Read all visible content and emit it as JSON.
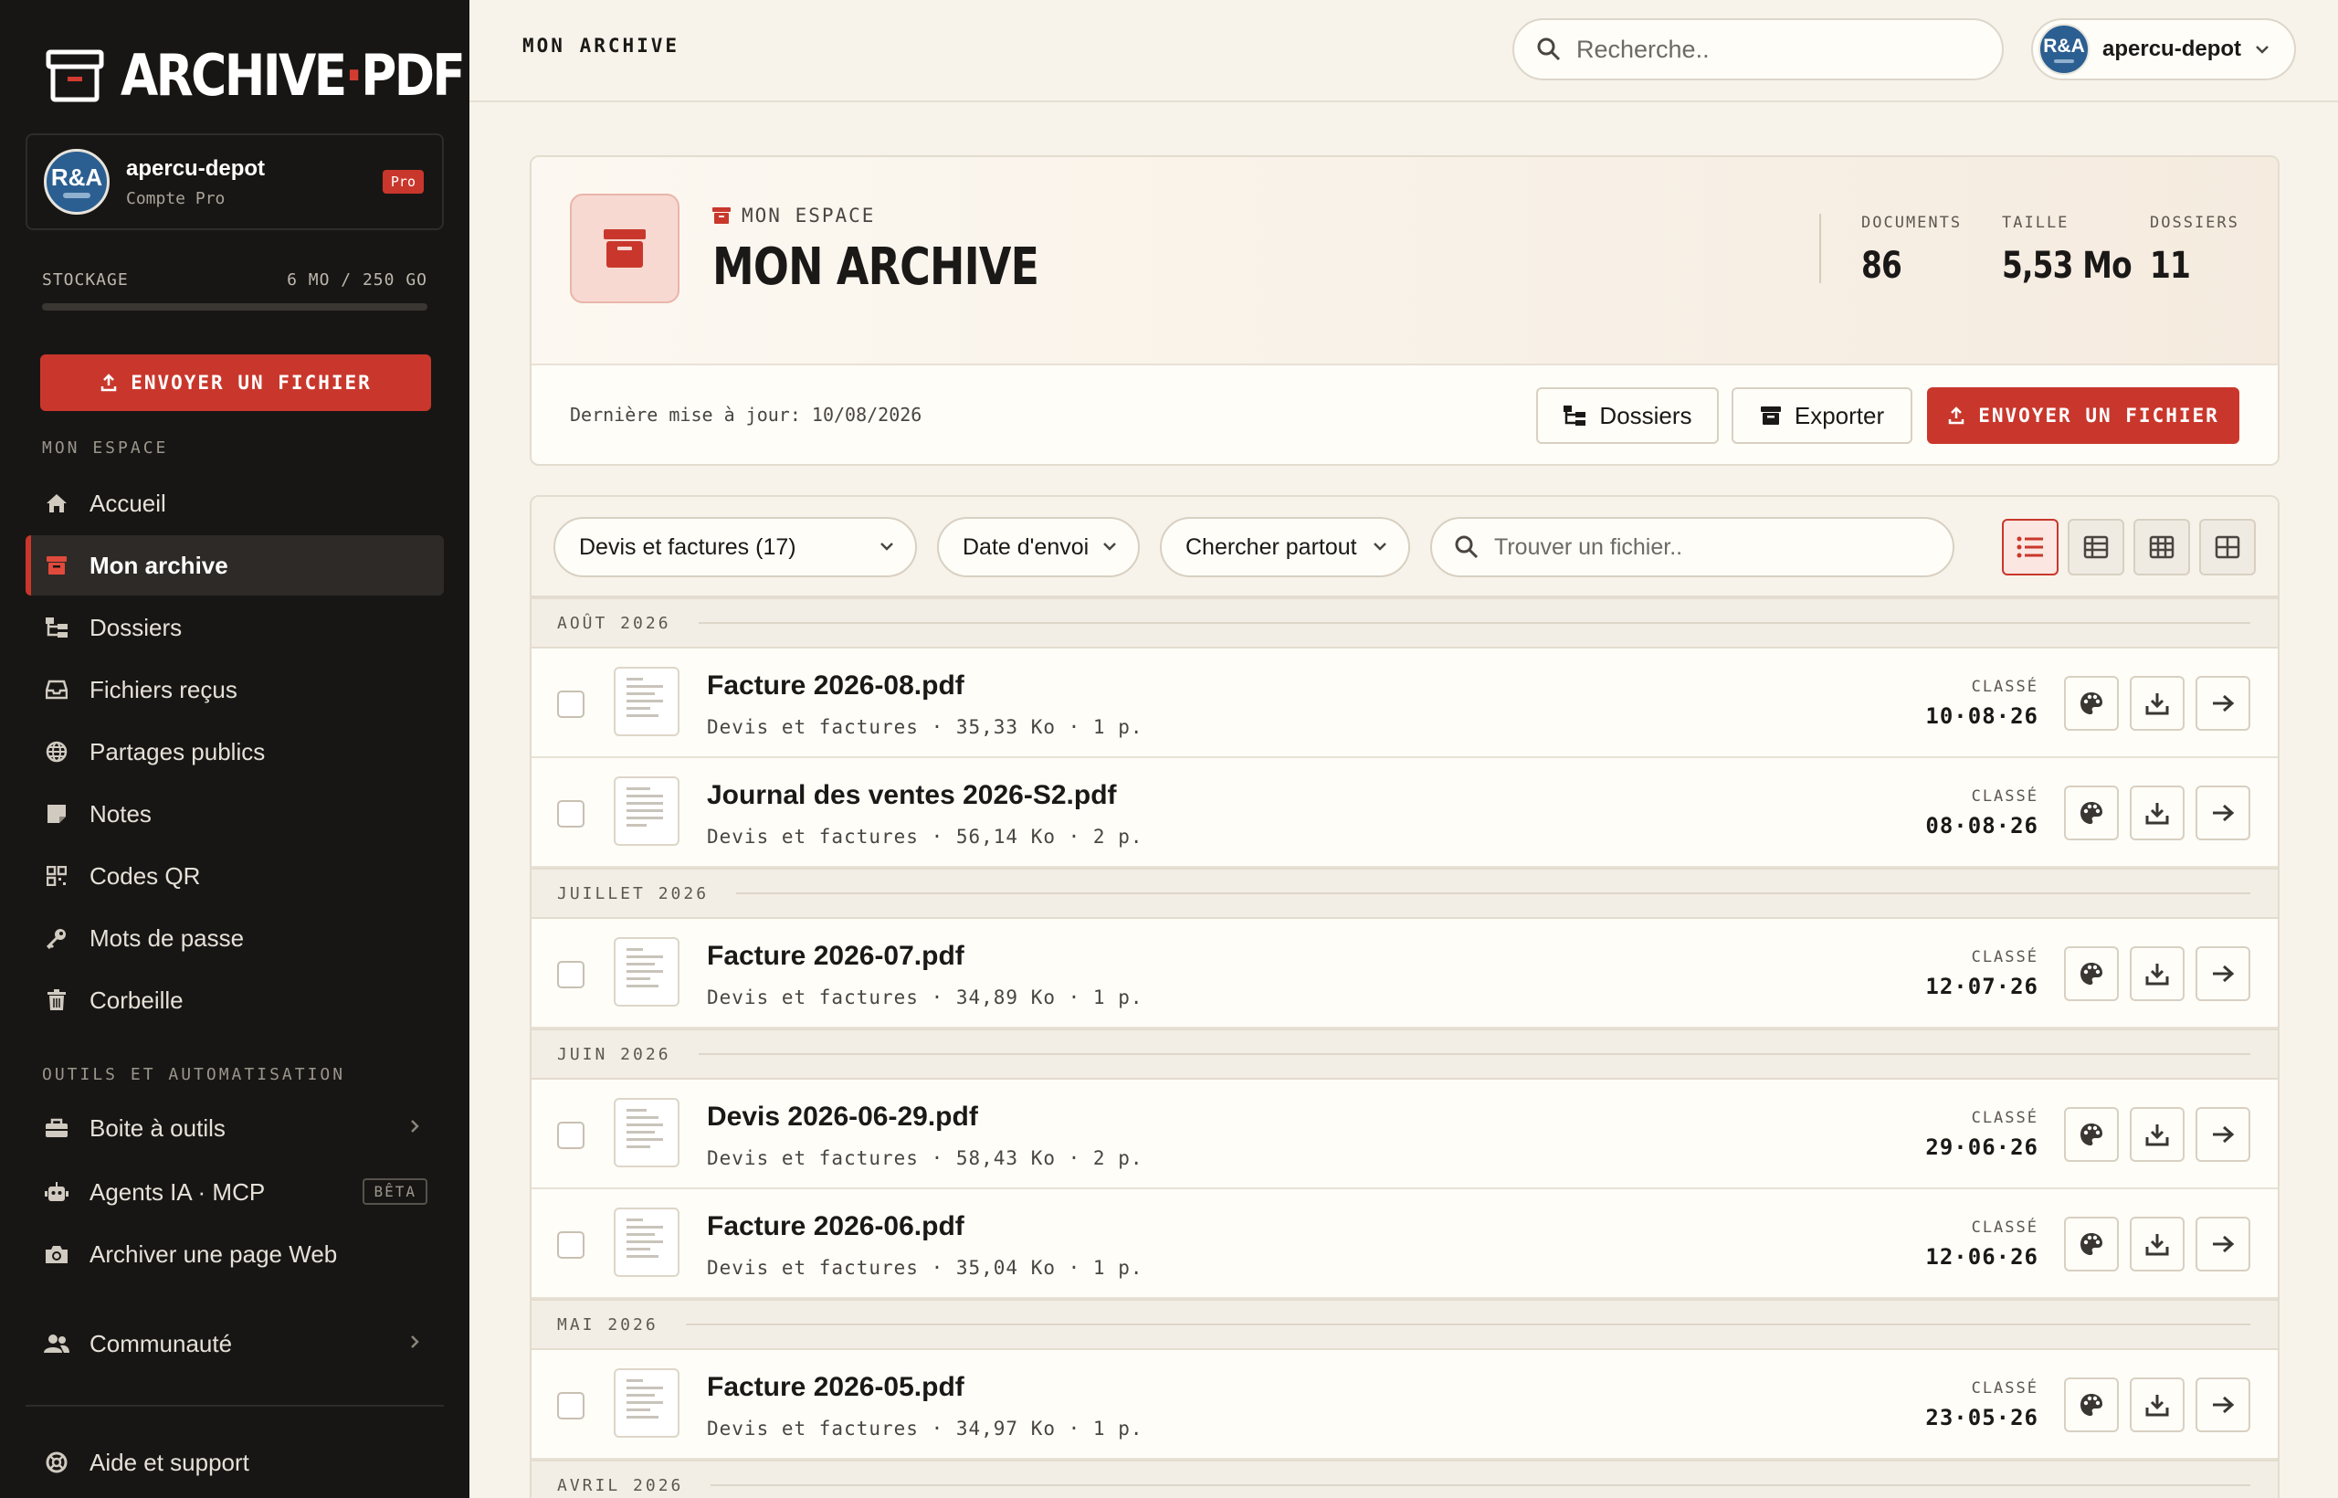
{
  "app": {
    "logo_left": "ARCHIVE",
    "logo_sep": "·",
    "logo_right": "PDF"
  },
  "account": {
    "avatar_text": "R&A",
    "name": "apercu-depot",
    "plan": "Compte Pro",
    "badge": "Pro"
  },
  "storage": {
    "label": "STOCKAGE",
    "value": "6 MO / 250 GO",
    "used_fraction": 2e-05
  },
  "sidebar": {
    "upload_label": "ENVOYER UN FICHIER",
    "section1": "MON ESPACE",
    "items": [
      {
        "label": "Accueil",
        "icon": "home-icon"
      },
      {
        "label": "Mon archive",
        "icon": "archive-icon",
        "active": true
      },
      {
        "label": "Dossiers",
        "icon": "folder-tree-icon"
      },
      {
        "label": "Fichiers reçus",
        "icon": "inbox-icon"
      },
      {
        "label": "Partages publics",
        "icon": "globe-icon"
      },
      {
        "label": "Notes",
        "icon": "note-icon"
      },
      {
        "label": "Codes QR",
        "icon": "qr-icon"
      },
      {
        "label": "Mots de passe",
        "icon": "key-icon"
      },
      {
        "label": "Corbeille",
        "icon": "trash-icon"
      }
    ],
    "section2": "OUTILS ET AUTOMATISATION",
    "tools": [
      {
        "label": "Boite à outils",
        "icon": "toolbox-icon"
      },
      {
        "label": "Agents IA · MCP",
        "icon": "robot-icon",
        "badge": "BÊTA"
      },
      {
        "label": "Archiver une page Web",
        "icon": "camera-icon"
      }
    ],
    "community": "Communauté",
    "help": "Aide et support"
  },
  "topbar": {
    "title": "MON ARCHIVE",
    "search_placeholder": "Recherche..",
    "user": "apercu-depot"
  },
  "header": {
    "crumb": "MON ESPACE",
    "title": "MON ARCHIVE",
    "stats": [
      {
        "label": "DOCUMENTS",
        "value": "86"
      },
      {
        "label": "TAILLE",
        "value": "5,53 Mo"
      },
      {
        "label": "DOSSIERS",
        "value": "11"
      }
    ],
    "last_update": "Dernière mise à jour: 10/08/2026",
    "btn_folders": "Dossiers",
    "btn_export": "Exporter",
    "btn_upload": "ENVOYER UN FICHIER"
  },
  "filters": {
    "category": "Devis et factures (17)",
    "sort": "Date d'envoi",
    "scope": "Chercher partout",
    "search_placeholder": "Trouver un fichier.."
  },
  "groups": [
    "AOÛT 2026",
    "JUILLET 2026",
    "JUIN 2026",
    "MAI 2026",
    "AVRIL 2026"
  ],
  "files": [
    {
      "name": "Facture 2026-08.pdf",
      "meta": "Devis et factures · 35,33 Ko · 1 p.",
      "status": "CLASSÉ",
      "date": "10·08·26"
    },
    {
      "name": "Journal des ventes 2026-S2.pdf",
      "meta": "Devis et factures · 56,14 Ko · 2 p.",
      "status": "CLASSÉ",
      "date": "08·08·26"
    },
    {
      "name": "Facture 2026-07.pdf",
      "meta": "Devis et factures · 34,89 Ko · 1 p.",
      "status": "CLASSÉ",
      "date": "12·07·26"
    },
    {
      "name": "Devis 2026-06-29.pdf",
      "meta": "Devis et factures · 58,43 Ko · 2 p.",
      "status": "CLASSÉ",
      "date": "29·06·26"
    },
    {
      "name": "Facture 2026-06.pdf",
      "meta": "Devis et factures · 35,04 Ko · 1 p.",
      "status": "CLASSÉ",
      "date": "12·06·26"
    },
    {
      "name": "Facture 2026-05.pdf",
      "meta": "Devis et factures · 34,97 Ko · 1 p.",
      "status": "CLASSÉ",
      "date": "23·05·26"
    }
  ],
  "colors": {
    "accent": "#c9372c",
    "sidebar": "#181614",
    "background": "#f7f3ea"
  }
}
